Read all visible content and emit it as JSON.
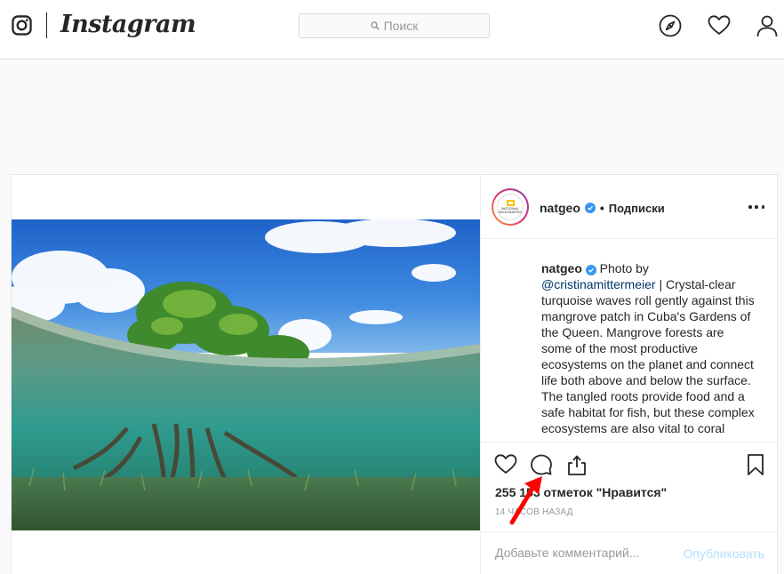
{
  "topbar": {
    "wordmark": "Instagram",
    "search_placeholder": "Поиск",
    "icons": [
      "instagram-glyph-icon",
      "search-icon",
      "explore-compass-icon",
      "activity-heart-icon",
      "profile-icon"
    ]
  },
  "post": {
    "username": "natgeo",
    "separator": "•",
    "follow_status": "Подписки",
    "avatar_label": "NATIONAL GEOGRAPHIC",
    "caption": {
      "username": "natgeo",
      "lead": " Photo by ",
      "mention": "@cristinamittermeier",
      "text": " | Crystal-clear turquoise waves roll gently against this mangrove patch in Cuba's Gardens of the Queen. Mangrove forests are some of the most productive ecosystems on the planet and connect life both above and below the surface. The tangled roots provide food and a safe habitat for fish, but these complex ecosystems are also vital to coral reefs."
    },
    "likes": "255 153 отметок \"Нравится\"",
    "time": "14 часов назад",
    "comment_placeholder": "Добавьте комментарий...",
    "publish_label": "Опубликовать"
  },
  "colors": {
    "accent": "#3897f0",
    "publish_disabled": "#b2dffc",
    "annotation_arrow": "#ff0000"
  }
}
